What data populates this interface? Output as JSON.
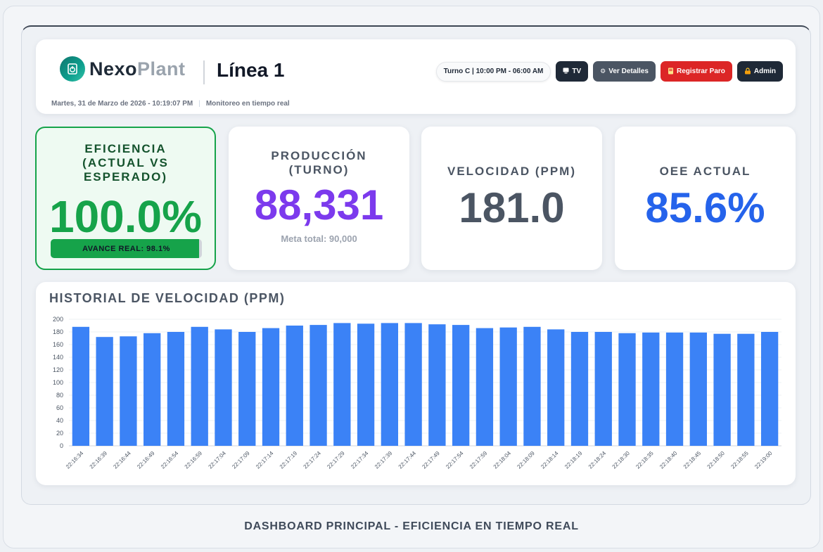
{
  "header": {
    "logo_nexo": "Nexo",
    "logo_plant": "Plant",
    "line_title": "Línea 1",
    "date_text": "Martes, 31 de Marzo de 2026 - 10:19:07 PM",
    "separator": "|",
    "status_text": "Monitoreo en tiempo real",
    "shift": "Turno C | 10:00 PM - 06:00 AM",
    "buttons": {
      "tv": "TV",
      "details": "Ver Detalles",
      "register_stop": "Registrar Paro",
      "admin": "Admin"
    },
    "icons": {
      "logo": "power-plug-icon",
      "tv": "tv-icon",
      "details": "gear-icon",
      "register_stop": "stop-sign-icon",
      "admin": "lock-icon"
    }
  },
  "kpis": {
    "efficiency": {
      "title": "EFICIENCIA (ACTUAL VS ESPERADO)",
      "value": "100.0%",
      "progress_label": "AVANCE REAL: 98.1%",
      "progress_fraction": 0.981
    },
    "production": {
      "title": "PRODUCCIÓN (TURNO)",
      "value": "88,331",
      "meta": "Meta total: 90,000"
    },
    "speed": {
      "title": "VELOCIDAD (PPM)",
      "value": "181.0"
    },
    "oee": {
      "title": "OEE ACTUAL",
      "value": "85.6%"
    }
  },
  "chart_title": "HISTORIAL DE VELOCIDAD (PPM)",
  "chart_data": {
    "type": "bar",
    "title": "HISTORIAL DE VELOCIDAD (PPM)",
    "xlabel": "",
    "ylabel": "",
    "ylim": [
      0,
      200
    ],
    "yticks": [
      0,
      20,
      40,
      60,
      80,
      100,
      120,
      140,
      160,
      180,
      200
    ],
    "grid": true,
    "color": "#3b82f6",
    "categories": [
      "22:16:34",
      "22:16:39",
      "22:16:44",
      "22:16:49",
      "22:16:54",
      "22:16:59",
      "22:17:04",
      "22:17:09",
      "22:17:14",
      "22:17:19",
      "22:17:24",
      "22:17:29",
      "22:17:34",
      "22:17:39",
      "22:17:44",
      "22:17:49",
      "22:17:54",
      "22:17:59",
      "22:18:04",
      "22:18:09",
      "22:18:14",
      "22:18:19",
      "22:18:24",
      "22:18:30",
      "22:18:35",
      "22:18:40",
      "22:18:45",
      "22:18:50",
      "22:18:55",
      "22:19:00"
    ],
    "values": [
      188,
      172,
      173,
      178,
      180,
      188,
      184,
      180,
      186,
      190,
      191,
      194,
      193,
      194,
      194,
      192,
      191,
      186,
      187,
      188,
      184,
      180,
      180,
      178,
      179,
      179,
      179,
      177,
      177,
      180
    ]
  },
  "footer_caption": "DASHBOARD PRINCIPAL - EFICIENCIA EN TIEMPO REAL"
}
